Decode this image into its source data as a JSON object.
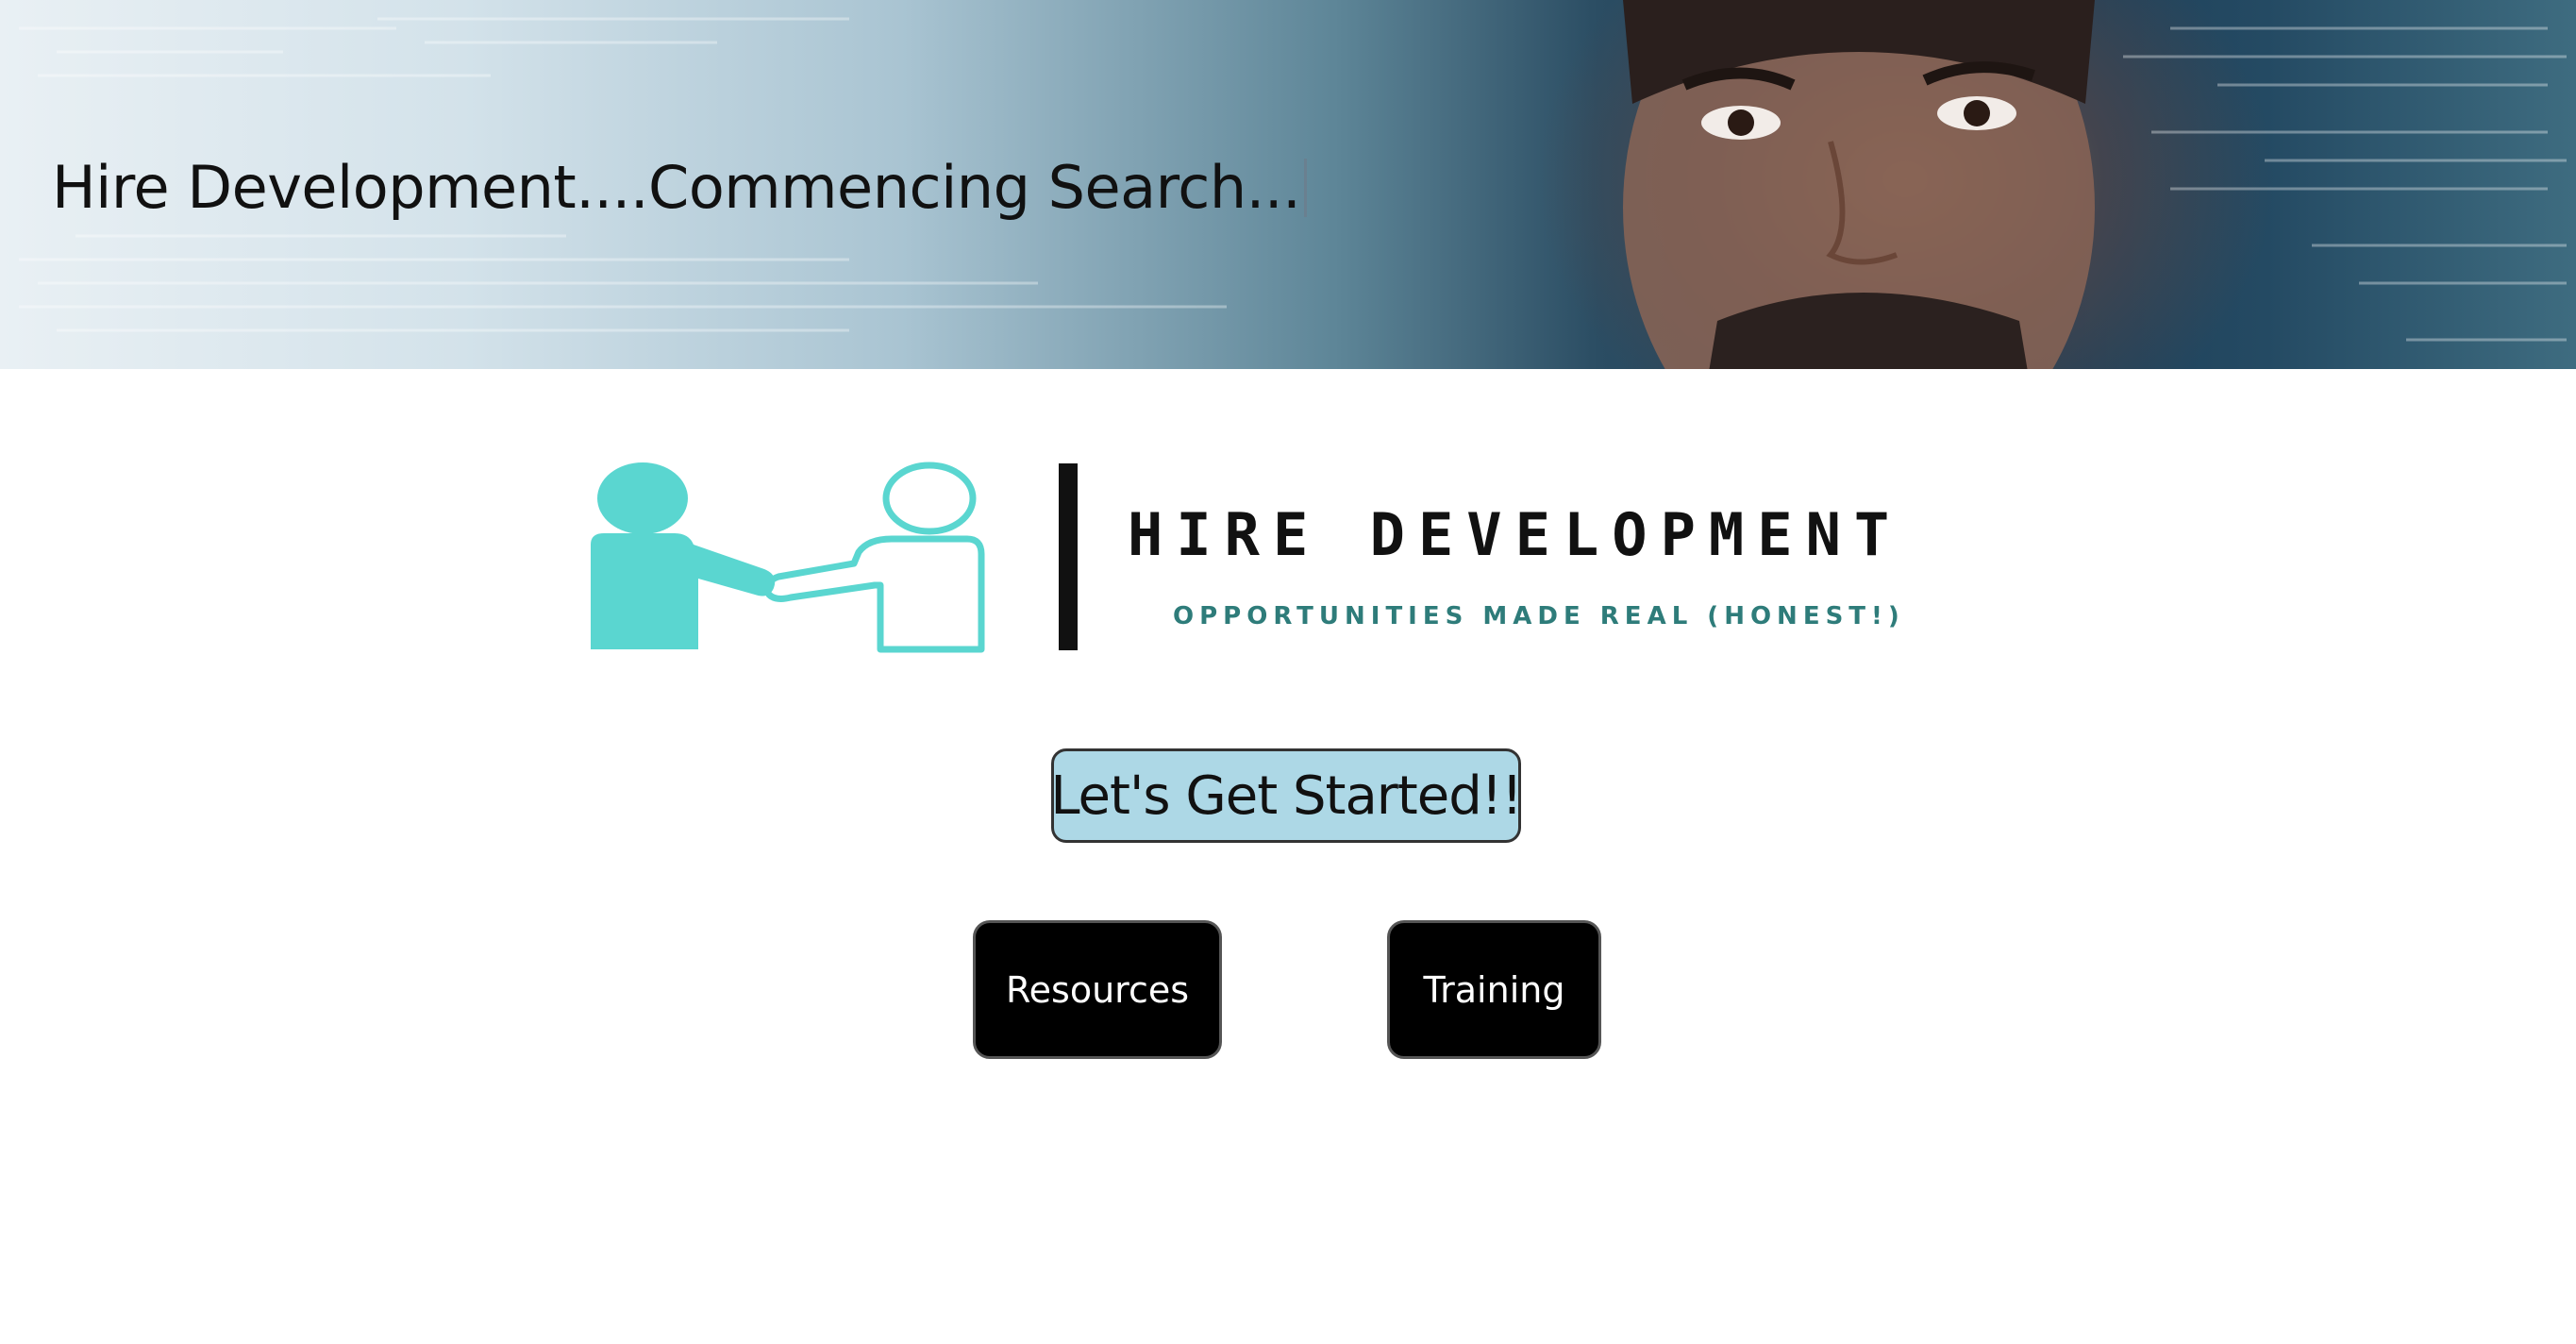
{
  "hero": {
    "title": "Hire Development....Commencing Search..."
  },
  "logo": {
    "wordmark": "HIRE DEVELOPMENT",
    "tagline": "OPPORTUNITIES MADE REAL (HONEST!)",
    "icon": "handshake-people-icon",
    "accent_color": "#5ad6d0"
  },
  "cta": {
    "label": "Let's Get Started!!",
    "color": "#add8e6"
  },
  "nav": {
    "resources_label": "Resources",
    "training_label": "Training"
  }
}
